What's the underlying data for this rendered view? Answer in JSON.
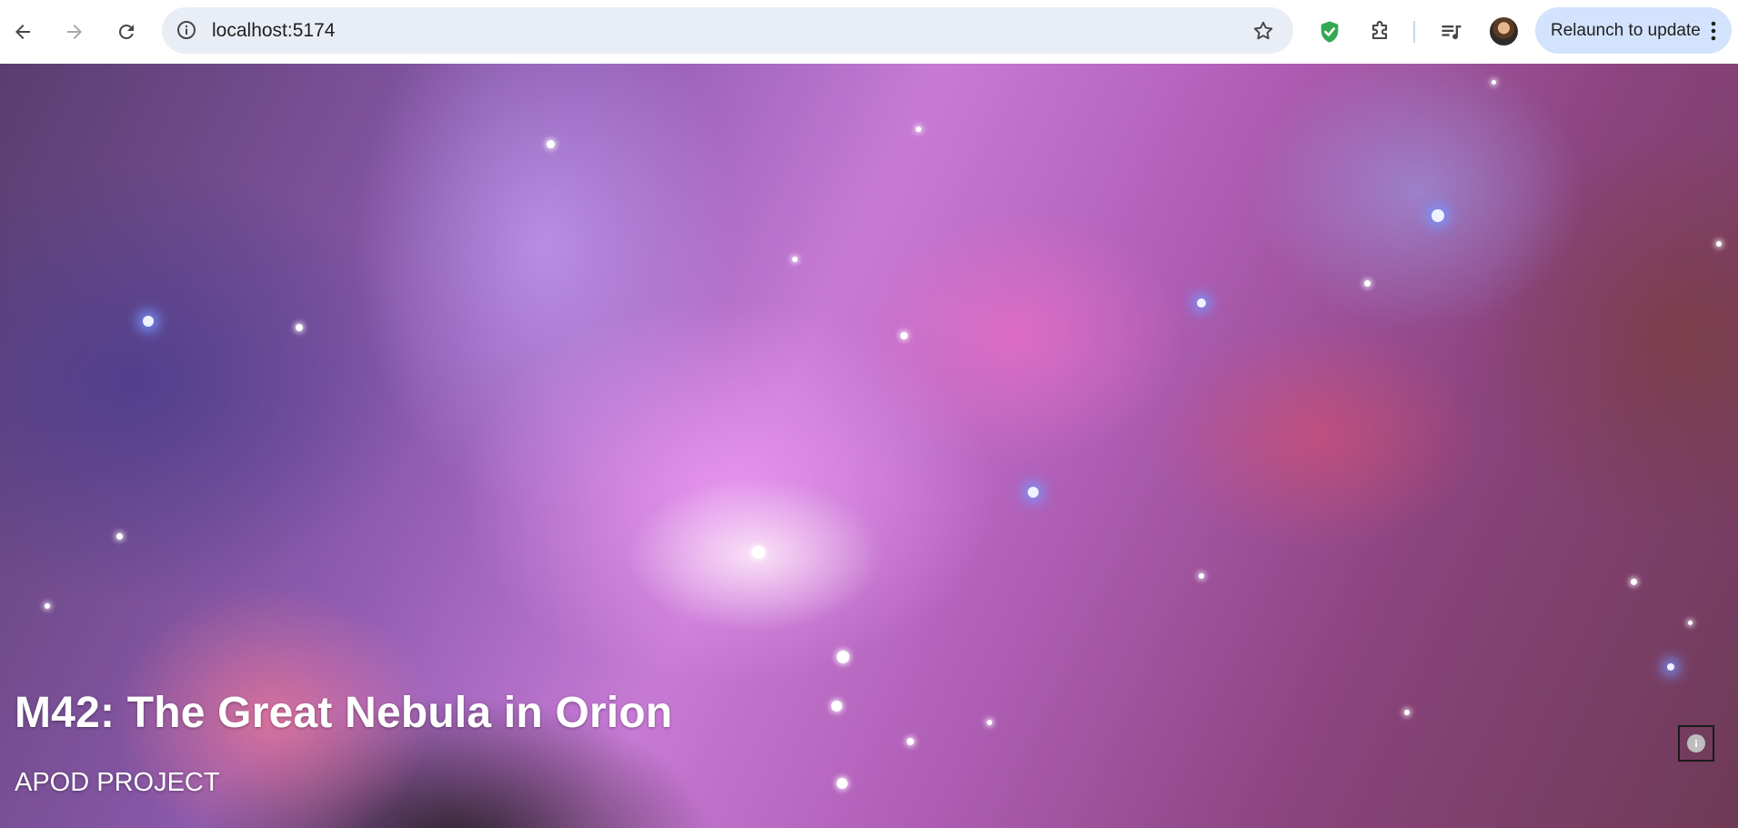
{
  "browser": {
    "address_bar": {
      "url": "localhost:5174"
    },
    "relaunch_button": {
      "label": "Relaunch to update"
    },
    "colors": {
      "omnibox_bg": "#e9eef6",
      "relaunch_bg": "#d3e3fd",
      "shield_green": "#34a853"
    }
  },
  "page": {
    "hero": {
      "title": "M42: The Great Nebula in Orion",
      "subtitle": "APOD PROJECT"
    },
    "icons": {
      "info_toggle": "info-icon"
    }
  }
}
